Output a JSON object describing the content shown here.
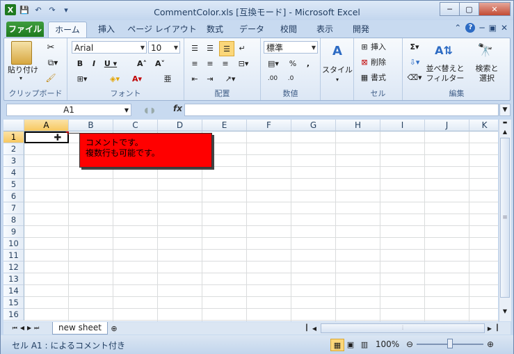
{
  "window": {
    "title": "CommentColor.xls  [互換モード] - Microsoft Excel",
    "minimize": "─",
    "maximize": "▢",
    "close": "✕"
  },
  "tabs": {
    "file": "ファイル",
    "home": "ホーム",
    "insert": "挿入",
    "page_layout": "ページ レイアウト",
    "formulas": "数式",
    "data": "データ",
    "review": "校閲",
    "view": "表示",
    "developer": "開発"
  },
  "ribbon": {
    "clipboard": {
      "paste": "貼り付け",
      "label": "クリップボード"
    },
    "font": {
      "name": "Arial",
      "size": "10",
      "label": "フォント"
    },
    "alignment": {
      "label": "配置"
    },
    "number": {
      "format": "標準",
      "label": "数値"
    },
    "styles": {
      "button": "スタイル"
    },
    "cells": {
      "insert": "挿入",
      "delete": "削除",
      "format": "書式",
      "label": "セル"
    },
    "editing": {
      "sort_filter": "並べ替えと\nフィルター",
      "find_select": "検索と\n選択",
      "label": "編集"
    }
  },
  "formula_bar": {
    "name_box": "A1",
    "fx": "fx",
    "formula": ""
  },
  "columns": [
    "A",
    "B",
    "C",
    "D",
    "E",
    "F",
    "G",
    "H",
    "I",
    "J",
    "K"
  ],
  "rows": [
    "1",
    "2",
    "3",
    "4",
    "5",
    "6",
    "7",
    "8",
    "9",
    "10",
    "11",
    "12",
    "13",
    "14",
    "15",
    "16"
  ],
  "comment": {
    "line1": "コメントです。",
    "line2": "複数行も可能です。",
    "color": "#ff0000"
  },
  "sheet": {
    "tab": "new sheet"
  },
  "status": {
    "text": "セル A1 :  によるコメント付き",
    "zoom": "100%"
  }
}
